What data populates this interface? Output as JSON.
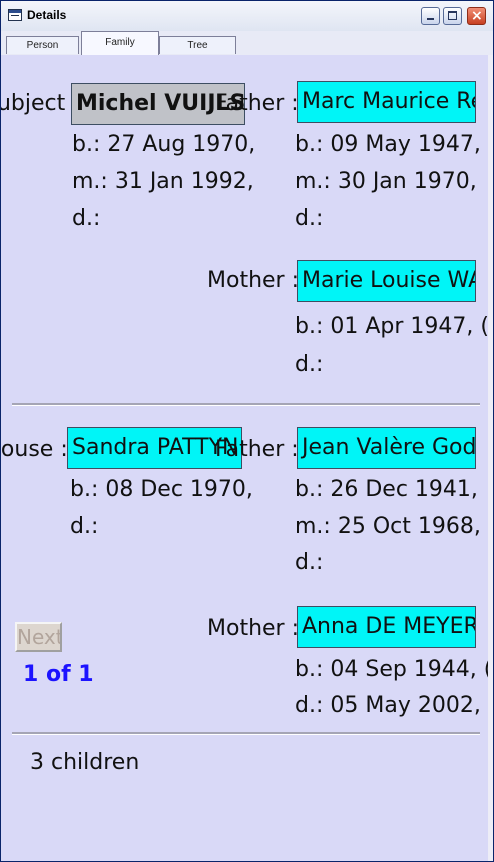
{
  "window": {
    "title": "Details"
  },
  "tabs": [
    {
      "label": "Person"
    },
    {
      "label": "Family",
      "active": true
    },
    {
      "label": "Tree"
    }
  ],
  "subject": {
    "label": "Subject :",
    "name": "Michel VUIJLS",
    "birth": "b.: 27 Aug 1970,",
    "marriage": "m.: 31 Jan 1992,",
    "death": "d.:"
  },
  "subject_father": {
    "label": "Father :",
    "name": "Marc Maurice Re",
    "birth": "b.: 09 May 1947,",
    "marriage": "m.: 30 Jan 1970,",
    "death": "d.:"
  },
  "subject_mother": {
    "label": "Mother :",
    "name": "Marie Louise WA",
    "birth": "b.: 01 Apr 1947, (",
    "death": "d.:"
  },
  "spouse": {
    "label": "Spouse :",
    "name": "Sandra PATTYN",
    "birth": "b.: 08 Dec 1970,",
    "death": "d.:"
  },
  "spouse_father": {
    "label": "Father :",
    "name": "Jean Valère God",
    "birth": "b.: 26 Dec 1941,",
    "marriage": "m.: 25 Oct 1968,",
    "death": "d.:"
  },
  "spouse_mother": {
    "label": "Mother :",
    "name": "Anna DE MEYER",
    "birth": "b.: 04 Sep 1944, (",
    "death": "d.: 05 May 2002,"
  },
  "navigation": {
    "next_label": "Next",
    "pager": "1 of  1"
  },
  "children": {
    "summary": "3 children"
  },
  "colors": {
    "background": "#d9d9f7",
    "person_name": "#00f5f7",
    "subject_name": "#c0c2c8",
    "pager": "#1c13ff"
  }
}
